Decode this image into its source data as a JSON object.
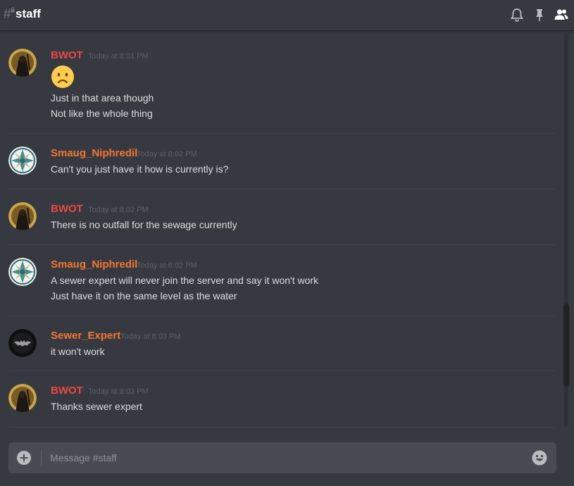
{
  "header": {
    "channel": "staff"
  },
  "messages": [
    {
      "author": "BWOT",
      "author_color": "#f04747",
      "timestamp": "Today at 8:01 PM",
      "avatar": "hooded-figure-avatar",
      "emoji": "frowning-face",
      "lines": [
        "Just in that area though",
        "Not like the whole thing"
      ]
    },
    {
      "author": "Smaug_Niphredil",
      "author_color": "#f57731",
      "timestamp": "Today at 8:02 PM",
      "avatar": "mandala-avatar",
      "lines": [
        "Can't you just have it how is currently is?"
      ]
    },
    {
      "author": "BWOT",
      "author_color": "#f04747",
      "timestamp": "Today at 8:02 PM",
      "avatar": "hooded-figure-avatar",
      "lines": [
        "There is no outfall for the sewage currently"
      ]
    },
    {
      "author": "Smaug_Niphredil",
      "author_color": "#f57731",
      "timestamp": "Today at 8:02 PM",
      "avatar": "mandala-avatar",
      "lines": [
        "A sewer expert will never join the server and say it won't work",
        "Just have it on the same level as the water"
      ]
    },
    {
      "author": "Sewer_Expert",
      "author_color": "#f57731",
      "timestamp": "Today at 8:03 PM",
      "avatar": "bat-logo-avatar",
      "lines": [
        "it won't work"
      ]
    },
    {
      "author": "BWOT",
      "author_color": "#f04747",
      "timestamp": "Today at 8:03 PM",
      "avatar": "hooded-figure-avatar",
      "lines": [
        "Thanks sewer expert"
      ]
    }
  ],
  "composer": {
    "placeholder": "Message #staff"
  },
  "icons": {
    "header_right": [
      "bell-icon",
      "pin-icon",
      "members-icon"
    ],
    "composer_left": "plus-circle-icon",
    "composer_right": "emoji-picker-icon"
  },
  "colors": {
    "background": "#36393f",
    "composer": "#484b51",
    "role_red": "#f04747",
    "role_orange": "#f57731"
  }
}
